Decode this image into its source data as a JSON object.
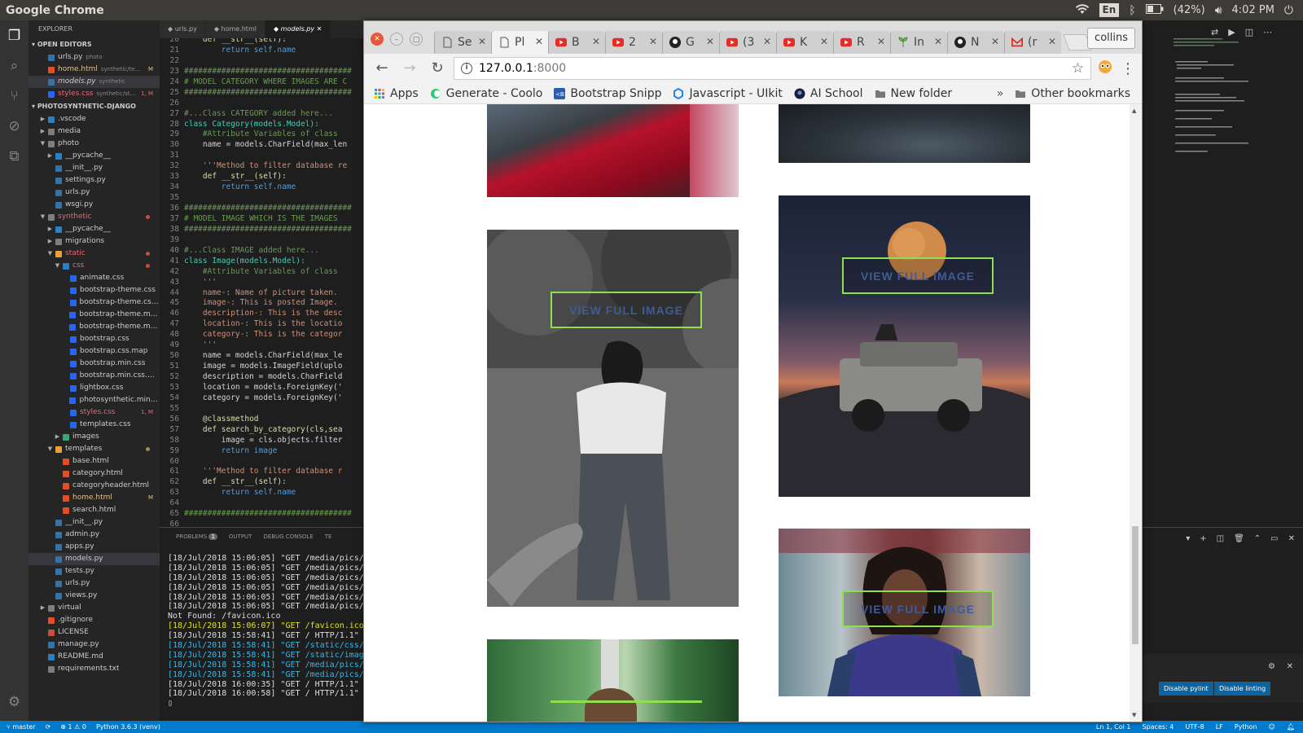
{
  "os": {
    "app_title": "Google Chrome",
    "lang": "En",
    "battery": "(42%)",
    "time": "4:02 PM",
    "user": "collins"
  },
  "vscode": {
    "explorer_title": "EXPLORER",
    "open_editors_label": "OPEN EDITORS",
    "open_editors": [
      {
        "label": "urls.py",
        "desc": "photo",
        "color": "#3572a5"
      },
      {
        "label": "home.html",
        "desc": "synthetic/te...",
        "badge": "M",
        "color": "#e44d26"
      },
      {
        "label": "models.py",
        "desc": "synthetic",
        "color": "#3572a5"
      },
      {
        "label": "styles.css",
        "desc": "synthetic/st...",
        "badge": "1, M",
        "color": "#2965f1",
        "red": true
      }
    ],
    "project_label": "PHOTOSYNTHETIC-DJANGO",
    "tree": [
      {
        "label": ".vscode",
        "depth": 1,
        "folder": true,
        "arrow": "▶",
        "color": "#2a80c2"
      },
      {
        "label": "media",
        "depth": 1,
        "folder": true,
        "arrow": "▶",
        "color": "#7e7e7e"
      },
      {
        "label": "photo",
        "depth": 1,
        "folder": true,
        "arrow": "▼",
        "color": "#7e7e7e"
      },
      {
        "label": "__pycache__",
        "depth": 2,
        "folder": true,
        "arrow": "▶",
        "color": "#2a80c2"
      },
      {
        "label": "__init__.py",
        "depth": 2,
        "color": "#3572a5"
      },
      {
        "label": "settings.py",
        "depth": 2,
        "color": "#3572a5"
      },
      {
        "label": "urls.py",
        "depth": 2,
        "color": "#3572a5"
      },
      {
        "label": "wsgi.py",
        "depth": 2,
        "color": "#3572a5"
      },
      {
        "label": "synthetic",
        "depth": 1,
        "folder": true,
        "arrow": "▼",
        "color": "#7e7e7e",
        "red": true,
        "dot": "#c74e39"
      },
      {
        "label": "__pycache__",
        "depth": 2,
        "folder": true,
        "arrow": "▶",
        "color": "#2a80c2"
      },
      {
        "label": "migrations",
        "depth": 2,
        "folder": true,
        "arrow": "▶",
        "color": "#7e7e7e"
      },
      {
        "label": "static",
        "depth": 2,
        "folder": true,
        "arrow": "▼",
        "color": "#e8a33d",
        "red": true,
        "dot": "#c74e39"
      },
      {
        "label": "css",
        "depth": 3,
        "folder": true,
        "arrow": "▼",
        "color": "#2a80c2",
        "red": true,
        "dot": "#c74e39"
      },
      {
        "label": "animate.css",
        "depth": 4,
        "color": "#2965f1"
      },
      {
        "label": "bootstrap-theme.css",
        "depth": 4,
        "color": "#2965f1"
      },
      {
        "label": "bootstrap-theme.css....",
        "depth": 4,
        "color": "#2965f1"
      },
      {
        "label": "bootstrap-theme.min....",
        "depth": 4,
        "color": "#2965f1"
      },
      {
        "label": "bootstrap-theme.min....",
        "depth": 4,
        "color": "#2965f1"
      },
      {
        "label": "bootstrap.css",
        "depth": 4,
        "color": "#2965f1"
      },
      {
        "label": "bootstrap.css.map",
        "depth": 4,
        "color": "#2965f1"
      },
      {
        "label": "bootstrap.min.css",
        "depth": 4,
        "color": "#2965f1"
      },
      {
        "label": "bootstrap.min.css.map",
        "depth": 4,
        "color": "#2965f1"
      },
      {
        "label": "lightbox.css",
        "depth": 4,
        "color": "#2965f1"
      },
      {
        "label": "photosynthetic.min.css",
        "depth": 4,
        "color": "#2965f1"
      },
      {
        "label": "styles.css",
        "depth": 4,
        "color": "#2965f1",
        "red": true,
        "badge": "1, M"
      },
      {
        "label": "templates.css",
        "depth": 4,
        "color": "#2965f1"
      },
      {
        "label": "images",
        "depth": 3,
        "folder": true,
        "arrow": "▶",
        "color": "#3aa675"
      },
      {
        "label": "templates",
        "depth": 2,
        "folder": true,
        "arrow": "▼",
        "color": "#e8a33d",
        "dot": "#a08f4a"
      },
      {
        "label": "base.html",
        "depth": 3,
        "color": "#e44d26"
      },
      {
        "label": "category.html",
        "depth": 3,
        "color": "#e44d26"
      },
      {
        "label": "categoryheader.html",
        "depth": 3,
        "color": "#e44d26"
      },
      {
        "label": "home.html",
        "depth": 3,
        "color": "#e44d26",
        "badge": "M",
        "yellow": true
      },
      {
        "label": "search.html",
        "depth": 3,
        "color": "#e44d26"
      },
      {
        "label": "__init__.py",
        "depth": 2,
        "color": "#3572a5"
      },
      {
        "label": "admin.py",
        "depth": 2,
        "color": "#3572a5"
      },
      {
        "label": "apps.py",
        "depth": 2,
        "color": "#3572a5"
      },
      {
        "label": "models.py",
        "depth": 2,
        "color": "#3572a5",
        "selected": true
      },
      {
        "label": "tests.py",
        "depth": 2,
        "color": "#3572a5"
      },
      {
        "label": "urls.py",
        "depth": 2,
        "color": "#3572a5"
      },
      {
        "label": "views.py",
        "depth": 2,
        "color": "#3572a5"
      },
      {
        "label": "virtual",
        "depth": 1,
        "folder": true,
        "arrow": "▶",
        "color": "#7e7e7e"
      },
      {
        "label": ".gitignore",
        "depth": 1,
        "color": "#e44d26"
      },
      {
        "label": "LICENSE",
        "depth": 1,
        "color": "#c74e39"
      },
      {
        "label": "manage.py",
        "depth": 1,
        "color": "#3572a5"
      },
      {
        "label": "README.md",
        "depth": 1,
        "color": "#2a80c2"
      },
      {
        "label": "requirements.txt",
        "depth": 1,
        "color": "#7e7e7e"
      }
    ],
    "editor_tabs": [
      {
        "label": "urls.py"
      },
      {
        "label": "home.html"
      },
      {
        "label": "models.py",
        "active": true
      }
    ],
    "code": [
      {
        "n": "20",
        "t": "    def __str__(self):",
        "k": "fn"
      },
      {
        "n": "21",
        "t": "        return self.name",
        "k": "kw"
      },
      {
        "n": "22",
        "t": "",
        "k": "ct"
      },
      {
        "n": "23",
        "t": "####################################",
        "k": "cm"
      },
      {
        "n": "24",
        "t": "# MODEL CATEGORY WHERE IMAGES ARE C",
        "k": "cm"
      },
      {
        "n": "25",
        "t": "####################################",
        "k": "cm"
      },
      {
        "n": "26",
        "t": "",
        "k": "ct"
      },
      {
        "n": "27",
        "t": "#...Class CATEGORY added here...",
        "k": "cm"
      },
      {
        "n": "28",
        "t": "class Category(models.Model):",
        "k": "cls"
      },
      {
        "n": "29",
        "t": "    #Attribute Variables of class",
        "k": "cm"
      },
      {
        "n": "30",
        "t": "    name = models.CharField(max_len",
        "k": "ct"
      },
      {
        "n": "31",
        "t": "",
        "k": "ct"
      },
      {
        "n": "32",
        "t": "    '''Method to filter database re",
        "k": "st"
      },
      {
        "n": "33",
        "t": "    def __str__(self):",
        "k": "fn"
      },
      {
        "n": "34",
        "t": "        return self.name",
        "k": "kw"
      },
      {
        "n": "35",
        "t": "",
        "k": "ct"
      },
      {
        "n": "36",
        "t": "####################################",
        "k": "cm"
      },
      {
        "n": "37",
        "t": "# MODEL IMAGE WHICH IS THE IMAGES",
        "k": "cm"
      },
      {
        "n": "38",
        "t": "####################################",
        "k": "cm"
      },
      {
        "n": "39",
        "t": "",
        "k": "ct"
      },
      {
        "n": "40",
        "t": "#...Class IMAGE added here...",
        "k": "cm"
      },
      {
        "n": "41",
        "t": "class Image(models.Model):",
        "k": "cls"
      },
      {
        "n": "42",
        "t": "    #Attribute Variables of class",
        "k": "cm"
      },
      {
        "n": "43",
        "t": "    '''",
        "k": "st"
      },
      {
        "n": "44",
        "t": "    name-: Name of picture taken.",
        "k": "st"
      },
      {
        "n": "45",
        "t": "    image-: This is posted Image.",
        "k": "st"
      },
      {
        "n": "46",
        "t": "    description-: This is the desc",
        "k": "st"
      },
      {
        "n": "47",
        "t": "    location-: This is the locatio",
        "k": "st"
      },
      {
        "n": "48",
        "t": "    category-: This is the categor",
        "k": "st"
      },
      {
        "n": "49",
        "t": "    '''",
        "k": "st"
      },
      {
        "n": "50",
        "t": "    name = models.CharField(max_le",
        "k": "ct"
      },
      {
        "n": "51",
        "t": "    image = models.ImageField(uplo",
        "k": "ct"
      },
      {
        "n": "52",
        "t": "    description = models.CharField",
        "k": "ct"
      },
      {
        "n": "53",
        "t": "    location = models.ForeignKey('",
        "k": "ct"
      },
      {
        "n": "54",
        "t": "    category = models.ForeignKey('",
        "k": "ct"
      },
      {
        "n": "55",
        "t": "",
        "k": "ct"
      },
      {
        "n": "56",
        "t": "    @classmethod",
        "k": "fn"
      },
      {
        "n": "57",
        "t": "    def search_by_category(cls,sea",
        "k": "fn"
      },
      {
        "n": "58",
        "t": "        image = cls.objects.filter",
        "k": "ct"
      },
      {
        "n": "59",
        "t": "        return image",
        "k": "kw"
      },
      {
        "n": "60",
        "t": "",
        "k": "ct"
      },
      {
        "n": "61",
        "t": "    '''Method to filter database r",
        "k": "st"
      },
      {
        "n": "62",
        "t": "    def __str__(self):",
        "k": "fn"
      },
      {
        "n": "63",
        "t": "        return self.name",
        "k": "kw"
      },
      {
        "n": "64",
        "t": "",
        "k": "ct"
      },
      {
        "n": "65",
        "t": "####################################",
        "k": "cm"
      },
      {
        "n": "66",
        "t": "",
        "k": "ct"
      }
    ],
    "panel_tabs": {
      "problems": "PROBLEMS",
      "problems_count": "1",
      "output": "OUTPUT",
      "debug": "DEBUG CONSOLE",
      "terminal": "TE"
    },
    "terminal": [
      {
        "t": "[18/Jul/2018 15:06:05] \"GET /media/pics/",
        "c": ""
      },
      {
        "t": "[18/Jul/2018 15:06:05] \"GET /media/pics/",
        "c": ""
      },
      {
        "t": "[18/Jul/2018 15:06:05] \"GET /media/pics/",
        "c": ""
      },
      {
        "t": "[18/Jul/2018 15:06:05] \"GET /media/pics/",
        "c": ""
      },
      {
        "t": "[18/Jul/2018 15:06:05] \"GET /media/pics/",
        "c": ""
      },
      {
        "t": "[18/Jul/2018 15:06:05] \"GET /media/pics/",
        "c": ""
      },
      {
        "t": "Not Found: /favicon.ico",
        "c": ""
      },
      {
        "t": "[18/Jul/2018 15:06:07] \"GET /favicon.ico",
        "c": "yellow"
      },
      {
        "t": "[18/Jul/2018 15:58:41] \"GET / HTTP/1.1\" 2",
        "c": ""
      },
      {
        "t": "[18/Jul/2018 15:58:41] \"GET /static/css/",
        "c": "blue"
      },
      {
        "t": "[18/Jul/2018 15:58:41] \"GET /static/imag",
        "c": "blue"
      },
      {
        "t": "[18/Jul/2018 15:58:41] \"GET /media/pics/",
        "c": "blue"
      },
      {
        "t": "[18/Jul/2018 15:58:41] \"GET /media/pics/",
        "c": "blue"
      },
      {
        "t": "[18/Jul/2018 16:00:35] \"GET / HTTP/1.1\" 2",
        "c": ""
      },
      {
        "t": "[18/Jul/2018 16:00:58] \"GET / HTTP/1.1\" 2",
        "c": ""
      },
      {
        "t": "▯",
        "c": ""
      }
    ],
    "status": {
      "branch": "master",
      "errors": "⊗ 1 ⚠ 0",
      "python": "Python 3.6.3 (venv)",
      "ln": "Ln 1, Col 1",
      "spaces": "Spaces: 4",
      "enc": "UTF-8",
      "eol": "LF",
      "lang": "Python"
    },
    "right_buttons": {
      "pylint": "Disable pylint",
      "linting": "Disable linting"
    }
  },
  "chrome": {
    "tabs": [
      {
        "title": "Se",
        "fav": "doc"
      },
      {
        "title": "Pl",
        "fav": "doc",
        "active": true
      },
      {
        "title": "B",
        "fav": "yt"
      },
      {
        "title": "2",
        "fav": "yt"
      },
      {
        "title": "G",
        "fav": "gh"
      },
      {
        "title": "(3",
        "fav": "yt"
      },
      {
        "title": "K",
        "fav": "yt"
      },
      {
        "title": "R",
        "fav": "yt"
      },
      {
        "title": "In",
        "fav": "plant"
      },
      {
        "title": "N",
        "fav": "gh"
      },
      {
        "title": "(r",
        "fav": "gm"
      }
    ],
    "url_host": "127.0.0.1",
    "url_port": ":8000",
    "bookmarks": [
      {
        "label": "Apps",
        "icon": "apps"
      },
      {
        "label": "Generate - Coolo",
        "icon": "coolors"
      },
      {
        "label": "Bootstrap Snipp",
        "icon": "bs"
      },
      {
        "label": "Javascript - UIkit",
        "icon": "uikit"
      },
      {
        "label": "AI School",
        "icon": "ai"
      },
      {
        "label": "New folder",
        "icon": "folder"
      }
    ],
    "bookmarks_more": "»",
    "other_bookmarks": "Other bookmarks",
    "view_button": "VIEW FULL IMAGE"
  }
}
